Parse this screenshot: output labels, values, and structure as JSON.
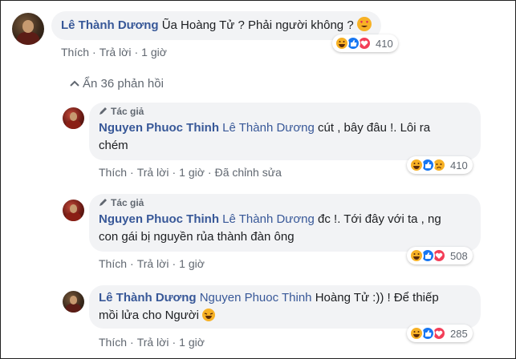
{
  "comments": [
    {
      "author_name": "Lê Thành Dương",
      "text": "Ũa Hoàng Tử ? Phải người không ?",
      "reaction_count": "410",
      "actions": [
        "Thích",
        "Trả lời",
        "1 giờ"
      ]
    }
  ],
  "replies_toggle": "Ẩn 36 phản hồi",
  "replies": [
    {
      "badge": "Tác giả",
      "author_name": "Nguyen Phuoc Thinh",
      "mention": "Lê Thành Dương",
      "text_line1": "cút , bây đâu !. Lôi ra",
      "text_line2": "chém",
      "reaction_count": "410",
      "actions": [
        "Thích",
        "Trả lời",
        "1 giờ",
        "Đã chỉnh sửa"
      ]
    },
    {
      "badge": "Tác giả",
      "author_name": "Nguyen Phuoc Thinh",
      "mention": "Lê Thành Dương",
      "text_line1": "đc !. Tới đây với ta , ng",
      "text_line2": "con gái bị nguyền rủa thành đàn ông",
      "reaction_count": "508",
      "actions": [
        "Thích",
        "Trả lời",
        "1 giờ"
      ]
    },
    {
      "author_name": "Lê Thành Dương",
      "mention": "Nguyen Phuoc Thinh",
      "text_line1": "Hoàng Tử :)) ! Để thiếp",
      "text_line2": "mồi lửa cho Người",
      "reaction_count": "285",
      "actions": [
        "Thích",
        "Trả lời",
        "1 giờ"
      ]
    }
  ],
  "colors": {
    "name": "#385898",
    "bubble": "#f2f3f5",
    "meta": "#606770"
  },
  "icons": [
    "pencil-icon",
    "haha-icon",
    "like-icon",
    "love-icon",
    "sad-icon",
    "heart-eyes-emoji",
    "laughing-emoji",
    "chevron-up-icon"
  ]
}
